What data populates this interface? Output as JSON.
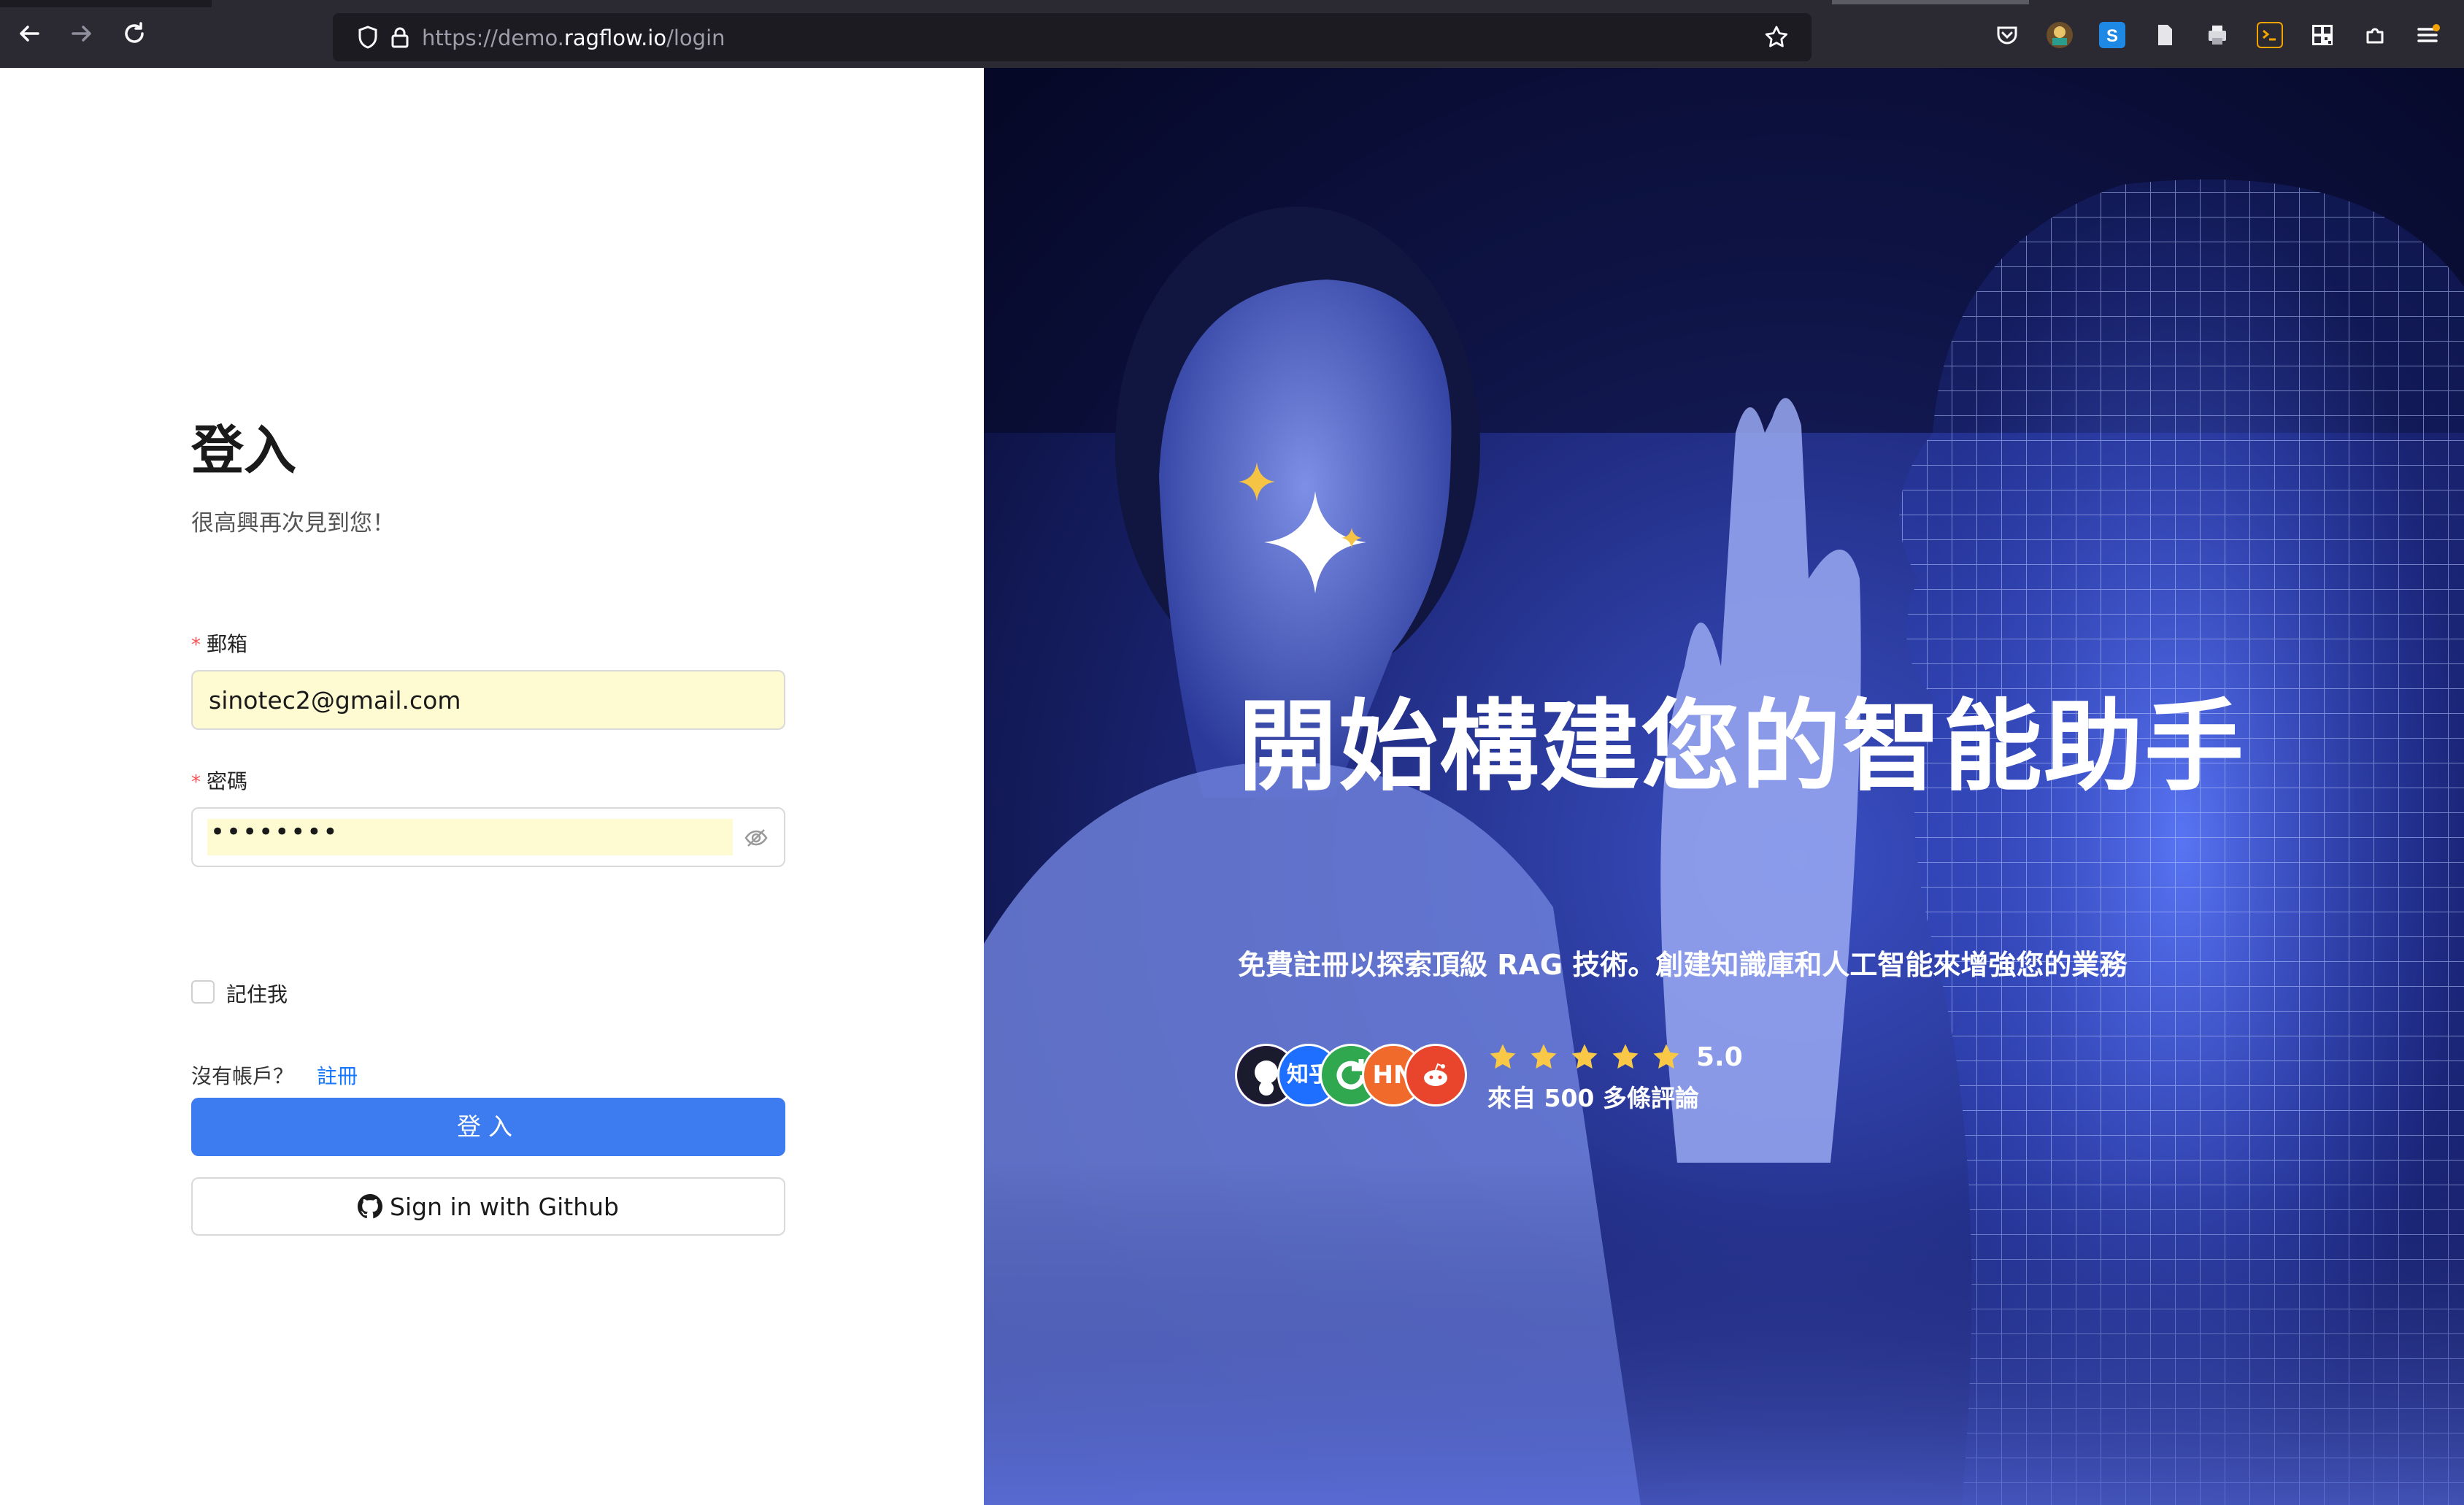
{
  "browser": {
    "url_prefix": "https://demo.",
    "url_host": "ragflow.io",
    "url_path": "/login",
    "back_icon": "back-arrow-icon",
    "forward_icon": "forward-arrow-icon",
    "reload_icon": "reload-icon"
  },
  "login": {
    "title": "登入",
    "subtitle": "很高興再次見到您！",
    "email_label": "郵箱",
    "email_value": "sinotec2@gmail.com",
    "password_label": "密碼",
    "password_masked": "••••••••",
    "remember_label": "記住我",
    "no_account_text": "沒有帳戶？",
    "signup_link": "註冊",
    "login_button": "登入",
    "github_button": "Sign in with Github",
    "required_mark": "*"
  },
  "hero": {
    "headline": "開始構建您的智能助手",
    "tagline": "免費註冊以探索頂級 RAG 技術。創建知識庫和人工智能來增強您的業務",
    "avatars": [
      {
        "name": "github",
        "text": ""
      },
      {
        "name": "zhihu",
        "text": "知乎"
      },
      {
        "name": "refresh-logo",
        "text": ""
      },
      {
        "name": "hacker-news",
        "text": "HN"
      },
      {
        "name": "reddit",
        "text": ""
      }
    ],
    "rating": "5.0",
    "stars": 5,
    "reviews": "來自 500 多條評論"
  },
  "colors": {
    "primary": "#3c7cf0",
    "link": "#1677ff",
    "required": "#ff4d4f",
    "autofill": "#fefbd2",
    "star": "#f9c846"
  }
}
